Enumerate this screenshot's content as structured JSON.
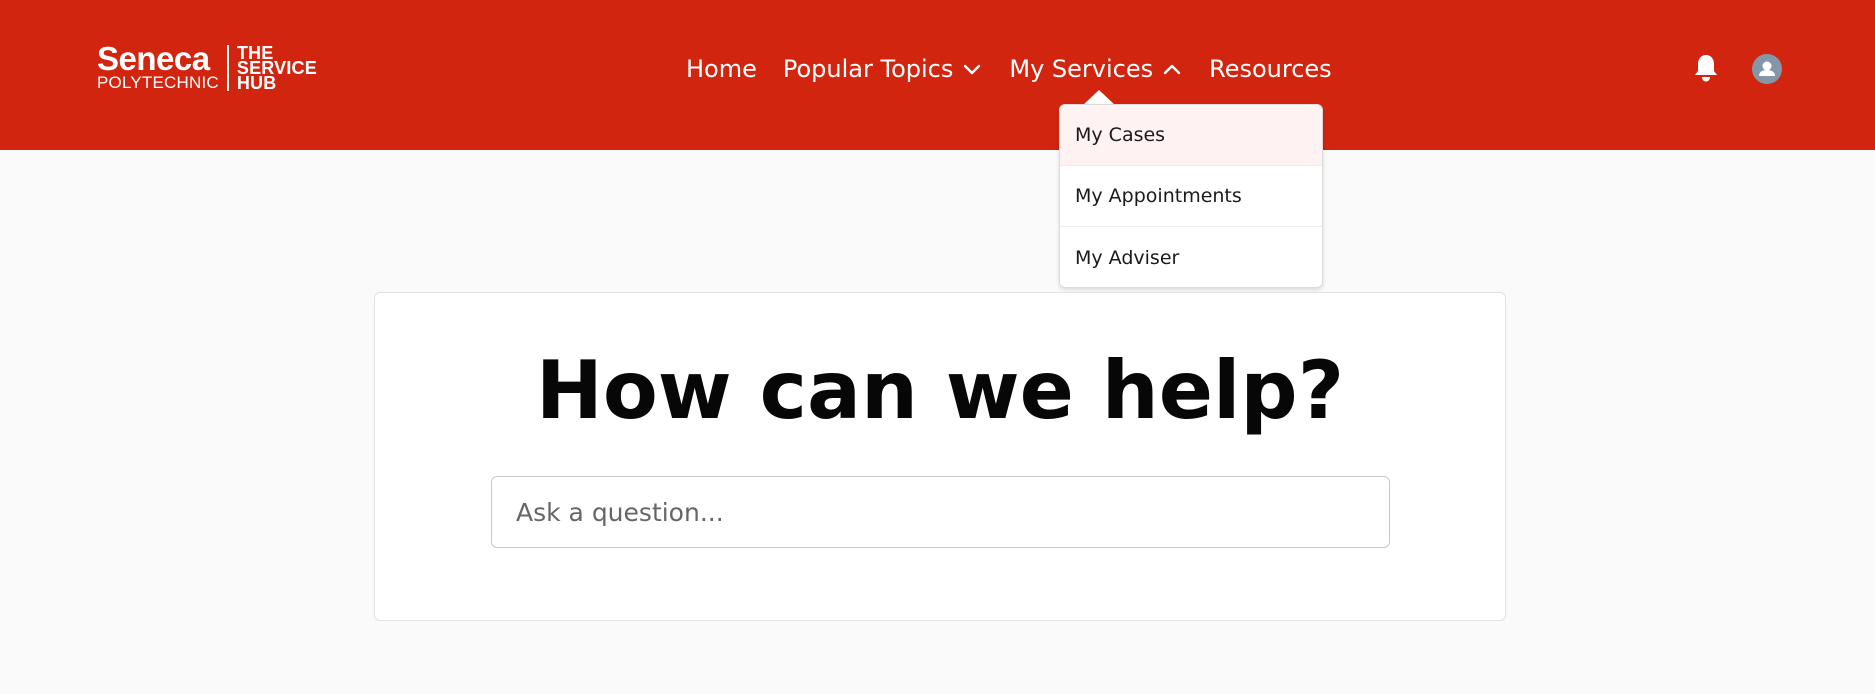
{
  "brand": {
    "name_line1": "Seneca",
    "name_line2": "POLYTECHNIC",
    "sub_line1": "THE",
    "sub_line2": "SERVICE",
    "sub_line3": "HUB"
  },
  "nav": {
    "items": [
      {
        "label": "Home",
        "chevron": null
      },
      {
        "label": "Popular Topics",
        "chevron": "chevron-down-icon"
      },
      {
        "label": "My Services",
        "chevron": "chevron-up-icon"
      },
      {
        "label": "Resources",
        "chevron": null
      }
    ]
  },
  "header_icons": {
    "notifications": "bell-icon",
    "profile": "avatar-icon"
  },
  "dropdown": {
    "items": [
      {
        "label": "My Cases",
        "active": true
      },
      {
        "label": "My Appointments",
        "active": false
      },
      {
        "label": "My Adviser",
        "active": false
      }
    ]
  },
  "hero": {
    "heading": "How can we help?",
    "search_placeholder": "Ask a question..."
  },
  "colors": {
    "header_bg": "#d22510",
    "page_bg": "#fafafa",
    "active_item_bg": "#fef3f2",
    "avatar_bg": "#8497a8"
  }
}
